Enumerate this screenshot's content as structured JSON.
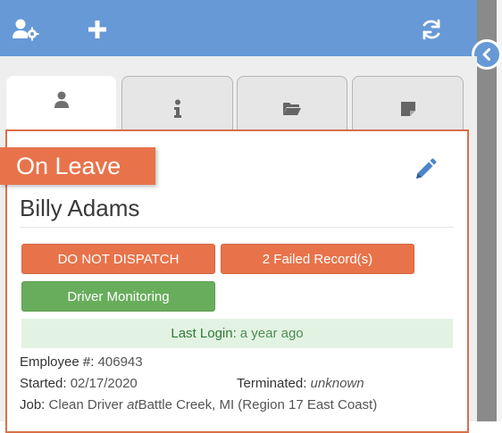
{
  "colors": {
    "header": "#6699d6",
    "accent_orange": "#e8734a",
    "accent_green": "#68ad5c",
    "login_bg": "#e3f3e3"
  },
  "toolbar": {
    "icons": [
      "user-settings-icon",
      "plus-icon",
      "refresh-icon"
    ]
  },
  "tabs": [
    {
      "icon": "person-icon",
      "active": true
    },
    {
      "icon": "info-icon",
      "active": false
    },
    {
      "icon": "folder-icon",
      "active": false
    },
    {
      "icon": "note-icon",
      "active": false
    }
  ],
  "status": "On Leave",
  "driver": {
    "name": "Billy Adams"
  },
  "badges": {
    "dispatch": "DO NOT DISPATCH",
    "failed": "2 Failed Record(s)",
    "monitoring": "Driver Monitoring"
  },
  "last_login": {
    "label": "Last Login:",
    "value": "a year ago"
  },
  "details": {
    "employee_label": "Employee #:",
    "employee_value": "406943",
    "started_label": "Started:",
    "started_value": "02/17/2020",
    "terminated_label": "Terminated:",
    "terminated_value": "unknown",
    "job_label": "Job:",
    "job_role": "Clean Driver",
    "job_at": "at",
    "job_location": "Battle Creek, MI (Region 17 East Coast)"
  }
}
